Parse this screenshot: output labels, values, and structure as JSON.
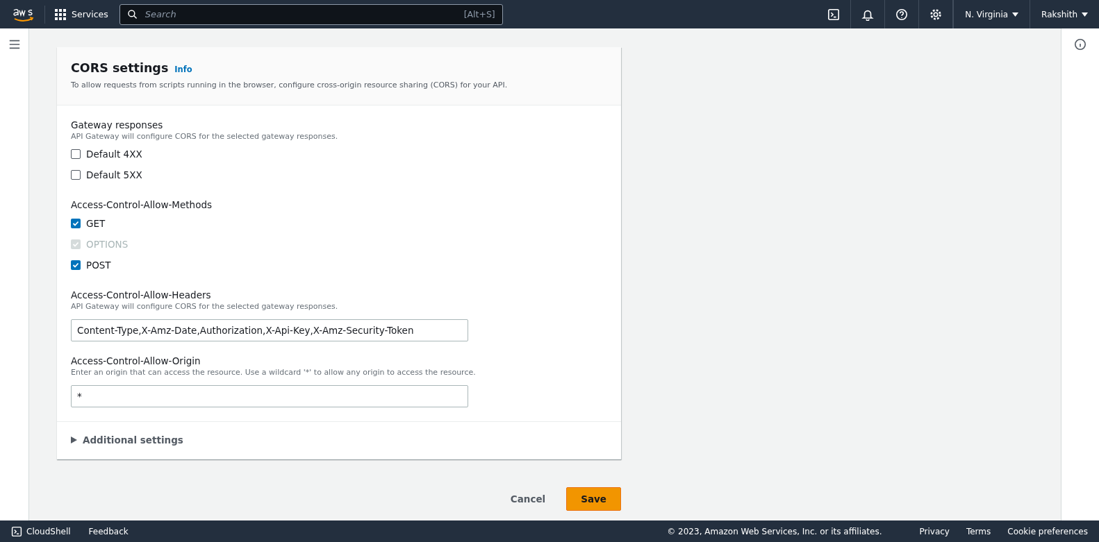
{
  "top_nav": {
    "services_label": "Services",
    "search": {
      "placeholder": "Search",
      "shortcut": "[Alt+S]"
    },
    "region": "N. Virginia",
    "user": "Rakshith"
  },
  "panel": {
    "title": "CORS settings",
    "info_link": "Info",
    "description": "To allow requests from scripts running in the browser, configure cross-origin resource sharing (CORS) for your API.",
    "gateway_responses": {
      "label": "Gateway responses",
      "hint": "API Gateway will configure CORS for the selected gateway responses.",
      "options": [
        {
          "label": "Default 4XX",
          "checked": false,
          "disabled": false
        },
        {
          "label": "Default 5XX",
          "checked": false,
          "disabled": false
        }
      ]
    },
    "allow_methods": {
      "label": "Access-Control-Allow-Methods",
      "options": [
        {
          "label": "GET",
          "checked": true,
          "disabled": false
        },
        {
          "label": "OPTIONS",
          "checked": true,
          "disabled": true
        },
        {
          "label": "POST",
          "checked": true,
          "disabled": false
        }
      ]
    },
    "allow_headers": {
      "label": "Access-Control-Allow-Headers",
      "hint": "API Gateway will configure CORS for the selected gateway responses.",
      "value": "Content-Type,X-Amz-Date,Authorization,X-Api-Key,X-Amz-Security-Token"
    },
    "allow_origin": {
      "label": "Access-Control-Allow-Origin",
      "hint": "Enter an origin that can access the resource. Use a wildcard '*' to allow any origin to access the resource.",
      "value": "*"
    },
    "additional_settings": {
      "label": "Additional settings",
      "expanded": false
    }
  },
  "actions": {
    "cancel": "Cancel",
    "save": "Save"
  },
  "footer": {
    "cloudshell": "CloudShell",
    "feedback": "Feedback",
    "copyright": "© 2023, Amazon Web Services, Inc. or its affiliates.",
    "links": [
      "Privacy",
      "Terms",
      "Cookie preferences"
    ]
  }
}
